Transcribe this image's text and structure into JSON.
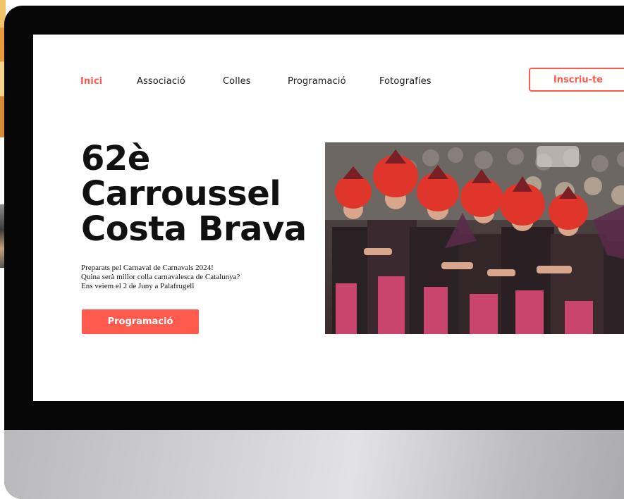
{
  "nav": {
    "items": [
      {
        "label": "Inici",
        "active": true
      },
      {
        "label": "Associació",
        "active": false
      },
      {
        "label": "Colles",
        "active": false
      },
      {
        "label": "Programació",
        "active": false
      },
      {
        "label": "Fotografies",
        "active": false
      }
    ],
    "cta_label": "Inscriu-te"
  },
  "hero": {
    "title_lines": [
      "62è",
      "Carroussel",
      "Costa Brava"
    ],
    "text_lines": [
      "Preparats pel Carnaval de Carnavals 2024!",
      "Quina serà millor colla carnavalesca de Catalunya?",
      "Ens veiem el 2 de Juny a Palafrugell"
    ],
    "button_label": "Programació",
    "image_alt": "carnival-dancers-photo"
  },
  "colors": {
    "accent": "#ff5a4e",
    "text": "#111111",
    "bezel": "#070707"
  }
}
